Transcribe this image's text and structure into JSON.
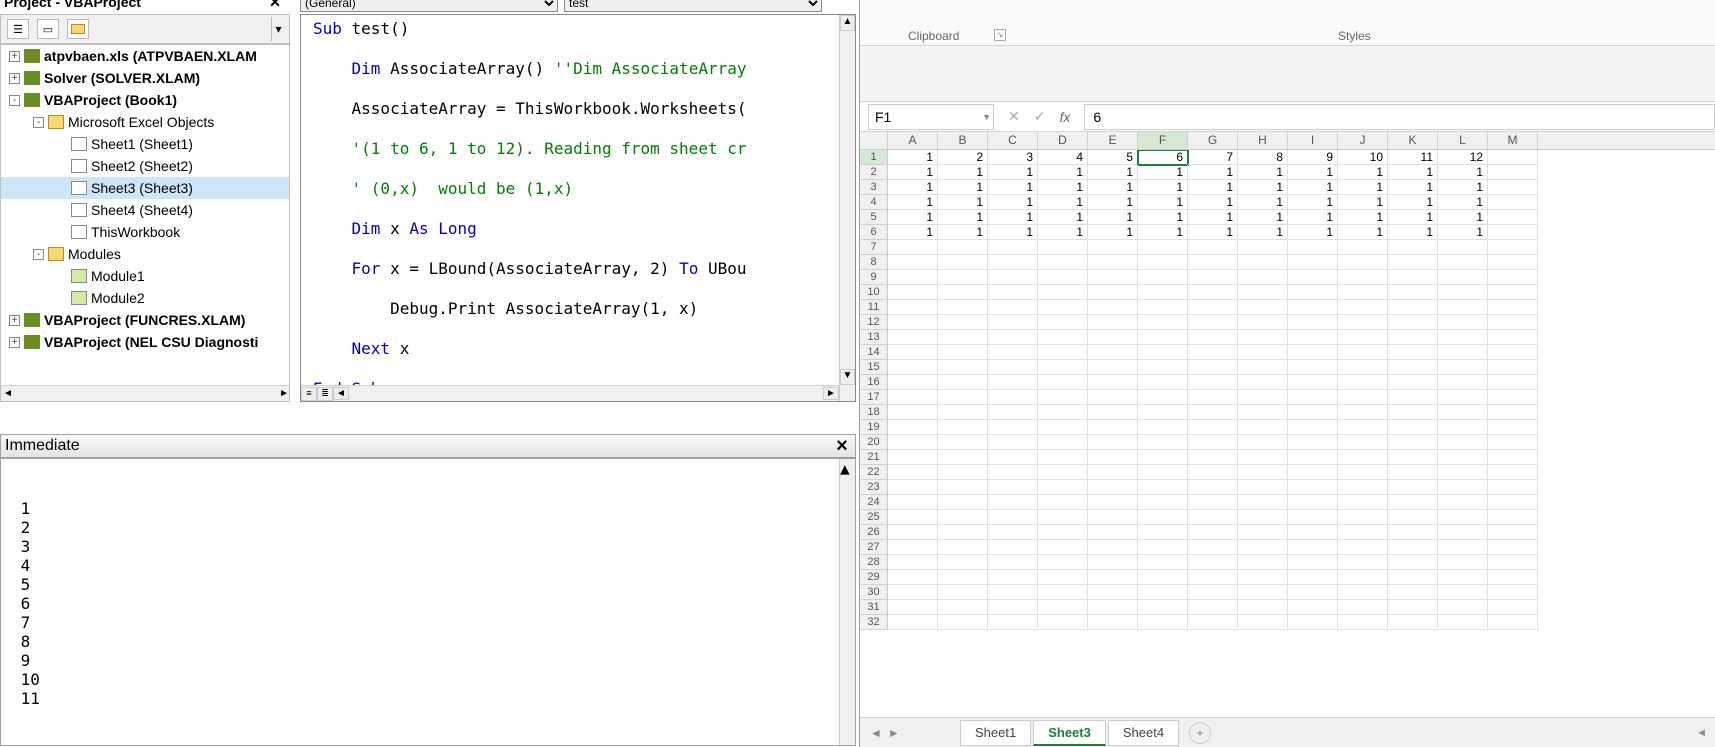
{
  "project_explorer": {
    "title": "Project - VBAProject",
    "tree": [
      {
        "indent": 8,
        "exp": "+",
        "ico": "proj-ico",
        "label": "atpvbaen.xls (ATPVBAEN.XLAM",
        "bold": true
      },
      {
        "indent": 8,
        "exp": "+",
        "ico": "proj-ico",
        "label": "Solver (SOLVER.XLAM)",
        "bold": true
      },
      {
        "indent": 8,
        "exp": "-",
        "ico": "proj-ico",
        "label": "VBAProject (Book1)",
        "bold": true
      },
      {
        "indent": 32,
        "exp": "-",
        "ico": "fold-ico",
        "label": "Microsoft Excel Objects"
      },
      {
        "indent": 70,
        "ico": "sheet-ico",
        "label": "Sheet1 (Sheet1)"
      },
      {
        "indent": 70,
        "ico": "sheet-ico",
        "label": "Sheet2 (Sheet2)"
      },
      {
        "indent": 70,
        "ico": "sheet-ico",
        "label": "Sheet3 (Sheet3)",
        "sel": true
      },
      {
        "indent": 70,
        "ico": "sheet-ico",
        "label": "Sheet4 (Sheet4)"
      },
      {
        "indent": 70,
        "ico": "sheet-ico",
        "label": "ThisWorkbook"
      },
      {
        "indent": 32,
        "exp": "-",
        "ico": "fold-ico",
        "label": "Modules"
      },
      {
        "indent": 70,
        "ico": "mod-ico",
        "label": "Module1"
      },
      {
        "indent": 70,
        "ico": "mod-ico",
        "label": "Module2"
      },
      {
        "indent": 8,
        "exp": "+",
        "ico": "proj-ico",
        "label": "VBAProject (FUNCRES.XLAM)",
        "bold": true
      },
      {
        "indent": 8,
        "exp": "+",
        "ico": "proj-ico",
        "label": "VBAProject (NEL CSU Diagnosti",
        "bold": true
      }
    ]
  },
  "code_dropdowns": {
    "left": "(General)",
    "right": "test"
  },
  "code": {
    "lines": [
      {
        "t": "Sub",
        "c": "kw"
      },
      {
        "t": " test()"
      },
      {
        "br": 1
      },
      {
        "br": 1
      },
      {
        "t": "    "
      },
      {
        "t": "Dim",
        "c": "kw"
      },
      {
        "t": " AssociateArray() "
      },
      {
        "t": "''Dim AssociateArray",
        "c": "cm"
      },
      {
        "br": 1
      },
      {
        "br": 1
      },
      {
        "t": "    AssociateArray = ThisWorkbook.Worksheets("
      },
      {
        "br": 1
      },
      {
        "br": 1
      },
      {
        "t": "    "
      },
      {
        "t": "'(1 to 6, 1 to 12). Reading from sheet cr",
        "c": "cm"
      },
      {
        "br": 1
      },
      {
        "br": 1
      },
      {
        "t": "    "
      },
      {
        "t": "' (0,x)  would be (1,x)",
        "c": "cm"
      },
      {
        "br": 1
      },
      {
        "br": 1
      },
      {
        "t": "    "
      },
      {
        "t": "Dim",
        "c": "kw"
      },
      {
        "t": " x "
      },
      {
        "t": "As Long",
        "c": "kw"
      },
      {
        "br": 1
      },
      {
        "br": 1
      },
      {
        "t": "    "
      },
      {
        "t": "For",
        "c": "kw"
      },
      {
        "t": " x = LBound(AssociateArray, 2) "
      },
      {
        "t": "To",
        "c": "kw"
      },
      {
        "t": " UBou"
      },
      {
        "br": 1
      },
      {
        "br": 1
      },
      {
        "t": "        Debug.Print AssociateArray(1, x)"
      },
      {
        "br": 1
      },
      {
        "br": 1
      },
      {
        "t": "    "
      },
      {
        "t": "Next",
        "c": "kw"
      },
      {
        "t": " x"
      },
      {
        "br": 1
      },
      {
        "br": 1
      },
      {
        "t": "End Sub",
        "c": "kw"
      }
    ]
  },
  "immediate": {
    "title": "Immediate",
    "lines": [
      " 1",
      " 2",
      " 3",
      " 4",
      " 5",
      " 6",
      " 7",
      " 8",
      " 9",
      " 10",
      " 11"
    ]
  },
  "excel": {
    "ribbon_groups": {
      "clipboard": "Clipboard",
      "styles": "Styles"
    },
    "namebox": "F1",
    "formula_value": "6",
    "active_cell": {
      "row": 1,
      "col": 6
    },
    "columns": [
      "A",
      "B",
      "C",
      "D",
      "E",
      "F",
      "G",
      "H",
      "I",
      "J",
      "K",
      "L",
      "M"
    ],
    "data": [
      [
        1,
        2,
        3,
        4,
        5,
        6,
        7,
        8,
        9,
        10,
        11,
        12,
        ""
      ],
      [
        1,
        1,
        1,
        1,
        1,
        1,
        1,
        1,
        1,
        1,
        1,
        1,
        ""
      ],
      [
        1,
        1,
        1,
        1,
        1,
        1,
        1,
        1,
        1,
        1,
        1,
        1,
        ""
      ],
      [
        1,
        1,
        1,
        1,
        1,
        1,
        1,
        1,
        1,
        1,
        1,
        1,
        ""
      ],
      [
        1,
        1,
        1,
        1,
        1,
        1,
        1,
        1,
        1,
        1,
        1,
        1,
        ""
      ],
      [
        1,
        1,
        1,
        1,
        1,
        1,
        1,
        1,
        1,
        1,
        1,
        1,
        ""
      ]
    ],
    "total_rows": 32,
    "sheet_tabs": [
      {
        "name": "Sheet1"
      },
      {
        "name": "Sheet3",
        "active": true
      },
      {
        "name": "Sheet4"
      }
    ]
  }
}
